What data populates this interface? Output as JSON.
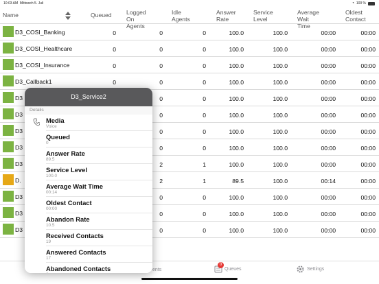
{
  "status_bar": {
    "time": "10:03 AM",
    "date": "Mittwoch 5. Juli",
    "battery": "100 %"
  },
  "table": {
    "columns": [
      {
        "label": "Name"
      },
      {
        "label": "Queued"
      },
      {
        "label": "Logged On Agents",
        "lines": [
          "Logged",
          "On Agents"
        ]
      },
      {
        "label": "Idle Agents",
        "lines": [
          "Idle",
          "Agents"
        ]
      },
      {
        "label": "Answer Rate",
        "lines": [
          "Answer",
          "Rate"
        ]
      },
      {
        "label": "Service Level",
        "lines": [
          "Service",
          "Level"
        ]
      },
      {
        "label": "Average Wait Time",
        "lines": [
          "Average",
          "Wait Time"
        ]
      },
      {
        "label": "Oldest Contact",
        "lines": [
          "Oldest",
          "Contact"
        ]
      }
    ],
    "rows": [
      {
        "name": "D3_COSI_Banking",
        "status": "green",
        "queued": "0",
        "logged_on": "0",
        "idle": "0",
        "answer_rate": "100.0",
        "service_level": "100.0",
        "avg_wait": "00:00",
        "oldest": "00:00"
      },
      {
        "name": "D3_COSI_Healthcare",
        "status": "green",
        "queued": "0",
        "logged_on": "0",
        "idle": "0",
        "answer_rate": "100.0",
        "service_level": "100.0",
        "avg_wait": "00:00",
        "oldest": "00:00"
      },
      {
        "name": "D3_COSI_Insurance",
        "status": "green",
        "queued": "0",
        "logged_on": "0",
        "idle": "0",
        "answer_rate": "100.0",
        "service_level": "100.0",
        "avg_wait": "00:00",
        "oldest": "00:00"
      },
      {
        "name": "D3_Callback1",
        "status": "green",
        "queued": "0",
        "logged_on": "0",
        "idle": "0",
        "answer_rate": "100.0",
        "service_level": "100.0",
        "avg_wait": "00:00",
        "oldest": "00:00"
      },
      {
        "name": "D3",
        "status": "green",
        "queued": "",
        "logged_on": "0",
        "idle": "0",
        "answer_rate": "100.0",
        "service_level": "100.0",
        "avg_wait": "00:00",
        "oldest": "00:00"
      },
      {
        "name": "D3",
        "status": "green",
        "queued": "",
        "logged_on": "0",
        "idle": "0",
        "answer_rate": "100.0",
        "service_level": "100.0",
        "avg_wait": "00:00",
        "oldest": "00:00"
      },
      {
        "name": "D3",
        "status": "green",
        "queued": "",
        "logged_on": "0",
        "idle": "0",
        "answer_rate": "100.0",
        "service_level": "100.0",
        "avg_wait": "00:00",
        "oldest": "00:00"
      },
      {
        "name": "D3",
        "status": "green",
        "queued": "",
        "logged_on": "0",
        "idle": "0",
        "answer_rate": "100.0",
        "service_level": "100.0",
        "avg_wait": "00:00",
        "oldest": "00:00"
      },
      {
        "name": "D3",
        "status": "green",
        "queued": "",
        "logged_on": "2",
        "idle": "1",
        "answer_rate": "100.0",
        "service_level": "100.0",
        "avg_wait": "00:00",
        "oldest": "00:00"
      },
      {
        "name": "D.",
        "status": "orange",
        "queued": "",
        "logged_on": "2",
        "idle": "1",
        "answer_rate": "89.5",
        "service_level": "100.0",
        "avg_wait": "00:14",
        "oldest": "00:00"
      },
      {
        "name": "D3",
        "status": "green",
        "queued": "",
        "logged_on": "0",
        "idle": "0",
        "answer_rate": "100.0",
        "service_level": "100.0",
        "avg_wait": "00:00",
        "oldest": "00:00"
      },
      {
        "name": "D3",
        "status": "green",
        "queued": "",
        "logged_on": "0",
        "idle": "0",
        "answer_rate": "100.0",
        "service_level": "100.0",
        "avg_wait": "00:00",
        "oldest": "00:00"
      },
      {
        "name": "D3",
        "status": "green",
        "queued": "",
        "logged_on": "0",
        "idle": "0",
        "answer_rate": "100.0",
        "service_level": "100.0",
        "avg_wait": "00:00",
        "oldest": "00:00"
      }
    ]
  },
  "popover": {
    "title": "D3_Service2",
    "section": "Details",
    "items": [
      {
        "label": "Media",
        "value": "Voice"
      },
      {
        "label": "Queued",
        "value": "0"
      },
      {
        "label": "Answer Rate",
        "value": "89.5"
      },
      {
        "label": "Service Level",
        "value": "100.0"
      },
      {
        "label": "Average Wait Time",
        "value": "00:14"
      },
      {
        "label": "Oldest Contact",
        "value": "00:00"
      },
      {
        "label": "Abandon Rate",
        "value": "10.5"
      },
      {
        "label": "Received Contacts",
        "value": "19"
      },
      {
        "label": "Answered Contacts",
        "value": "17"
      },
      {
        "label": "Abandoned Contacts",
        "value": "2"
      }
    ]
  },
  "tab_bar": {
    "agents_partial": "ents",
    "queues": "Queues",
    "queues_badge": "0",
    "settings": "Settings"
  },
  "colors": {
    "green": "#7cb342",
    "orange": "#e6a817"
  }
}
